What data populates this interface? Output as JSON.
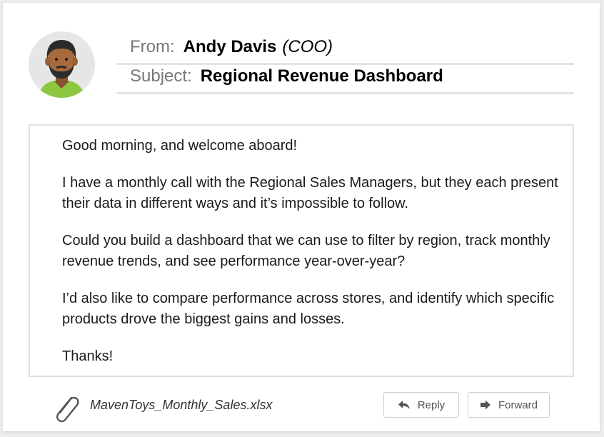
{
  "email": {
    "from_label": "From:",
    "from_name": "Andy Davis",
    "from_role": "(COO)",
    "subject_label": "Subject:",
    "subject": "Regional Revenue Dashboard"
  },
  "body": {
    "paragraphs": [
      "Good morning, and welcome aboard!",
      "I have a monthly call with the Regional Sales Managers, but they each present their data in different ways and it’s impossible to follow.",
      "Could you build a dashboard that we can use to filter by region, track monthly revenue trends, and see performance year-over-year?",
      "I’d also like to compare performance across stores, and identify which specific products drove the biggest gains and losses.",
      "Thanks!"
    ]
  },
  "attachment": {
    "filename": "MavenToys_Monthly_Sales.xlsx",
    "icon": "paperclip-icon"
  },
  "actions": {
    "reply_label": "Reply",
    "reply_icon": "reply-arrow-icon",
    "forward_label": "Forward",
    "forward_icon": "forward-arrow-icon"
  },
  "colors": {
    "avatar_shirt": "#8dc63f",
    "avatar_skin": "#a86a3d",
    "avatar_hair": "#2b2b2b"
  }
}
